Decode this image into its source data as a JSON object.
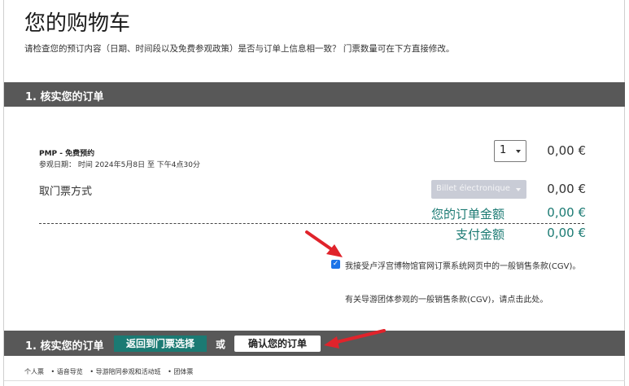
{
  "header": {
    "title": "您的购物车",
    "intro": "请检查您的预订内容（日期、时间段以及免费参观政策）是否与订单上信息相一致？ 门票数量可在下方直接修改。"
  },
  "section": {
    "label": "1. 核实您的订单"
  },
  "ticket": {
    "name": "PMP - 免费预约",
    "date": "参观日期： 时间 2024年5月8日 至 下午4点30分",
    "quantity": "1",
    "price": "0,00 €"
  },
  "pickup": {
    "label": "取门票方式",
    "method": "Billet électronique",
    "price": "0,00 €"
  },
  "totals": {
    "order_label": "您的订单金额",
    "order_value": "0,00 €",
    "pay_label": "支付金额",
    "pay_value": "0,00 €"
  },
  "cgv": {
    "checkbox_text": "我接受卢浮宫博物馆官网订票系统网页中的一般销售条款(CGV)。",
    "group_link": "有关导游团体参观的一般销售条款(CGV)，请点击此处。"
  },
  "actions": {
    "section_label": "1. 核实您的订单",
    "back_label": "返回到门票选择",
    "or_label": "或",
    "confirm_label": "确认您的订单"
  },
  "footer": {
    "links": [
      "个人票",
      "• 语音导览",
      "• 导游陪同参观和活动班",
      "• 团体票"
    ]
  },
  "colors": {
    "accent": "#1b7a73",
    "bar": "#585858",
    "arrow": "#e0232b",
    "checkbox": "#1a73e8"
  }
}
